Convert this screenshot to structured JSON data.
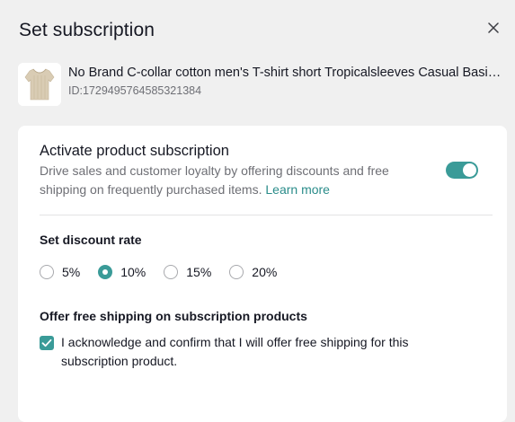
{
  "dialog": {
    "title": "Set subscription",
    "close_icon": "close-icon"
  },
  "product": {
    "name": "No Brand C-collar cotton men's T-shirt short Tropicalsleeves Casual Basic Tee",
    "id_text": "ID:1729495764585321384",
    "thumbnail_icon": "tshirt-thumbnail"
  },
  "activate": {
    "title": "Activate product subscription",
    "description": "Drive sales and customer loyalty by offering discounts and free shipping on frequently purchased items.",
    "learn_more": "Learn more",
    "toggle_on": true
  },
  "discount": {
    "label": "Set discount rate",
    "options": [
      "5%",
      "10%",
      "15%",
      "20%"
    ],
    "selected": "10%"
  },
  "shipping": {
    "label": "Offer free shipping on subscription products",
    "checkbox_text": "I acknowledge and confirm that I will offer free shipping for this subscription product.",
    "checked": true
  },
  "colors": {
    "accent": "#3a9b98",
    "link": "#2a8c8a",
    "background": "#f0f0f0",
    "card": "#ffffff",
    "muted_text": "#6e6f75"
  }
}
